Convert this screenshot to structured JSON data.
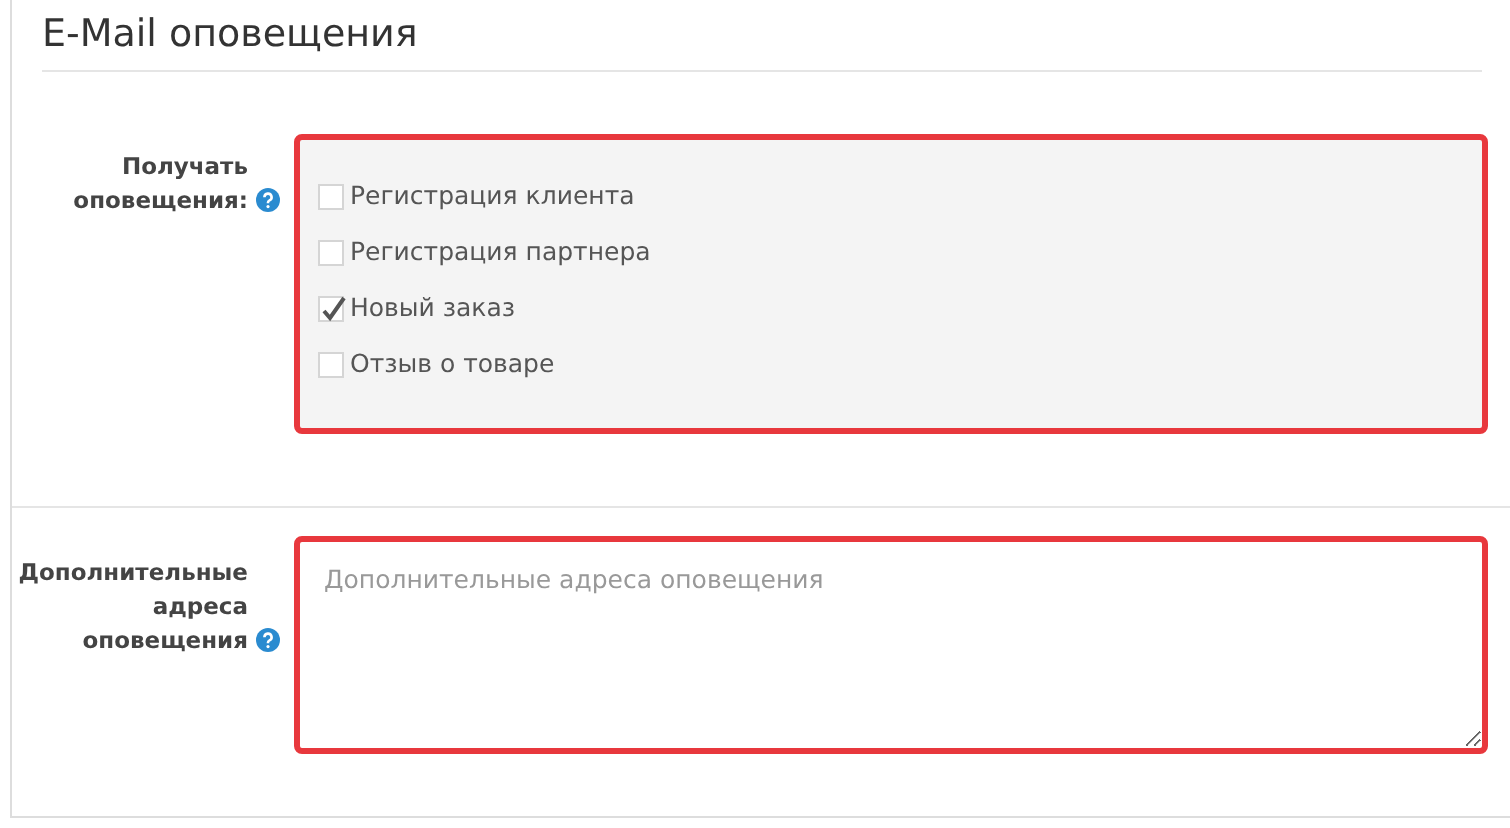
{
  "title": "E-Mail оповещения",
  "fields": [
    {
      "kind": "checkboxes",
      "label": "Получать оповещения:",
      "help": true,
      "options": [
        {
          "label": "Регистрация клиента",
          "checked": false
        },
        {
          "label": "Регистрация партнера",
          "checked": false
        },
        {
          "label": "Новый заказ",
          "checked": true
        },
        {
          "label": "Отзыв о товаре",
          "checked": false
        }
      ]
    },
    {
      "kind": "textarea",
      "label": "Дополнительные адреса оповещения",
      "help": true,
      "placeholder": "Дополнительные адреса оповещения"
    }
  ]
}
